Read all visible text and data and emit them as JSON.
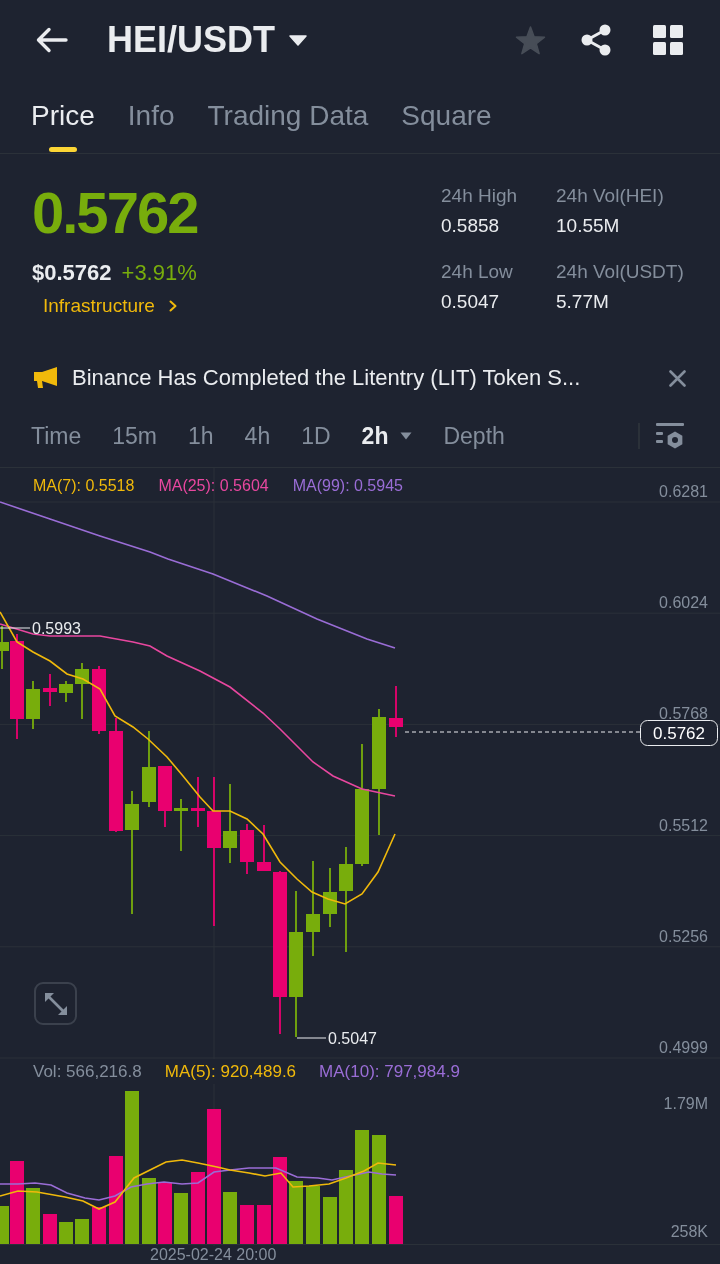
{
  "header": {
    "title": "HEI/USDT",
    "favorite": false
  },
  "tabs": [
    {
      "label": "Price",
      "selected": true
    },
    {
      "label": "Info",
      "selected": false
    },
    {
      "label": "Trading Data",
      "selected": false
    },
    {
      "label": "Square",
      "selected": false
    }
  ],
  "ticker": {
    "last_price": "0.5762",
    "usd_price": "$0.5762",
    "change": "+3.91%",
    "category": "Infrastructure",
    "stats": [
      {
        "label": "24h High",
        "value": "0.5858"
      },
      {
        "label": "24h Vol(HEI)",
        "value": "10.55M"
      },
      {
        "label": "24h Low",
        "value": "0.5047"
      },
      {
        "label": "24h Vol(USDT)",
        "value": "5.77M"
      }
    ]
  },
  "announcement": {
    "text": "Binance Has Completed the Litentry (LIT) Token S..."
  },
  "intervals": [
    {
      "label": "Time",
      "kind": "plain",
      "selected": false
    },
    {
      "label": "15m",
      "kind": "plain",
      "selected": false
    },
    {
      "label": "1h",
      "kind": "plain",
      "selected": false
    },
    {
      "label": "4h",
      "kind": "plain",
      "selected": false
    },
    {
      "label": "1D",
      "kind": "plain",
      "selected": false
    },
    {
      "label": "2h",
      "kind": "menu",
      "selected": true
    },
    {
      "label": "Depth",
      "kind": "plain",
      "selected": false
    }
  ],
  "chart": {
    "ma_legend": [
      {
        "label": "MA(7): 0.5518",
        "color": "#f0b90b"
      },
      {
        "label": "MA(25): 0.5604",
        "color": "#e8479f"
      },
      {
        "label": "MA(99): 0.5945",
        "color": "#9a6dd6"
      }
    ],
    "y_axis": [
      "0.6281",
      "0.6024",
      "0.5768",
      "0.5512",
      "0.5256",
      "0.4999"
    ],
    "high_label": "0.5993",
    "low_label": "0.5047",
    "current_price": "0.5762"
  },
  "volume": {
    "legend": [
      {
        "label": "Vol: 566,216.8",
        "color": "#848e9c"
      },
      {
        "label": "MA(5): 920,489.6",
        "color": "#f0b90b"
      },
      {
        "label": "MA(10): 797,984.9",
        "color": "#9a6dd6"
      }
    ],
    "y_axis": [
      "1.79M",
      "258K"
    ],
    "time_label": "2025-02-24 20:00"
  }
}
